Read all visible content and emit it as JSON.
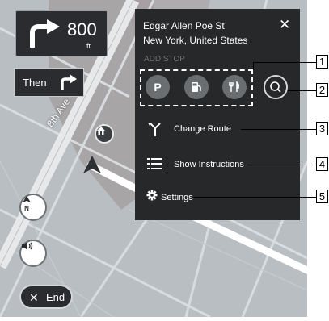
{
  "guidance": {
    "distance": "800",
    "unit": "ft",
    "then_label": "Then"
  },
  "map": {
    "street_label": "8th Ave"
  },
  "end_button": {
    "label": "End"
  },
  "panel": {
    "address_line1": "Edgar Allen Poe St",
    "address_line2": "New York, United States",
    "add_stop_label": "ADD STOP",
    "poi_buttons": [
      {
        "icon": "parking-icon",
        "glyph": "P"
      },
      {
        "icon": "fuel-icon",
        "glyph": ""
      },
      {
        "icon": "restaurant-icon",
        "glyph": ""
      }
    ],
    "menu": [
      {
        "label": "Change Route",
        "icon": "change-route-icon"
      },
      {
        "label": "Show Instructions",
        "icon": "list-icon"
      },
      {
        "label": "Settings",
        "icon": "gear-icon"
      }
    ]
  },
  "callouts": [
    "1",
    "2",
    "3",
    "4",
    "5"
  ],
  "colors": {
    "panel_bg": "#262829",
    "map_bg": "#b7bcc0",
    "route_white": "#ffffff"
  }
}
